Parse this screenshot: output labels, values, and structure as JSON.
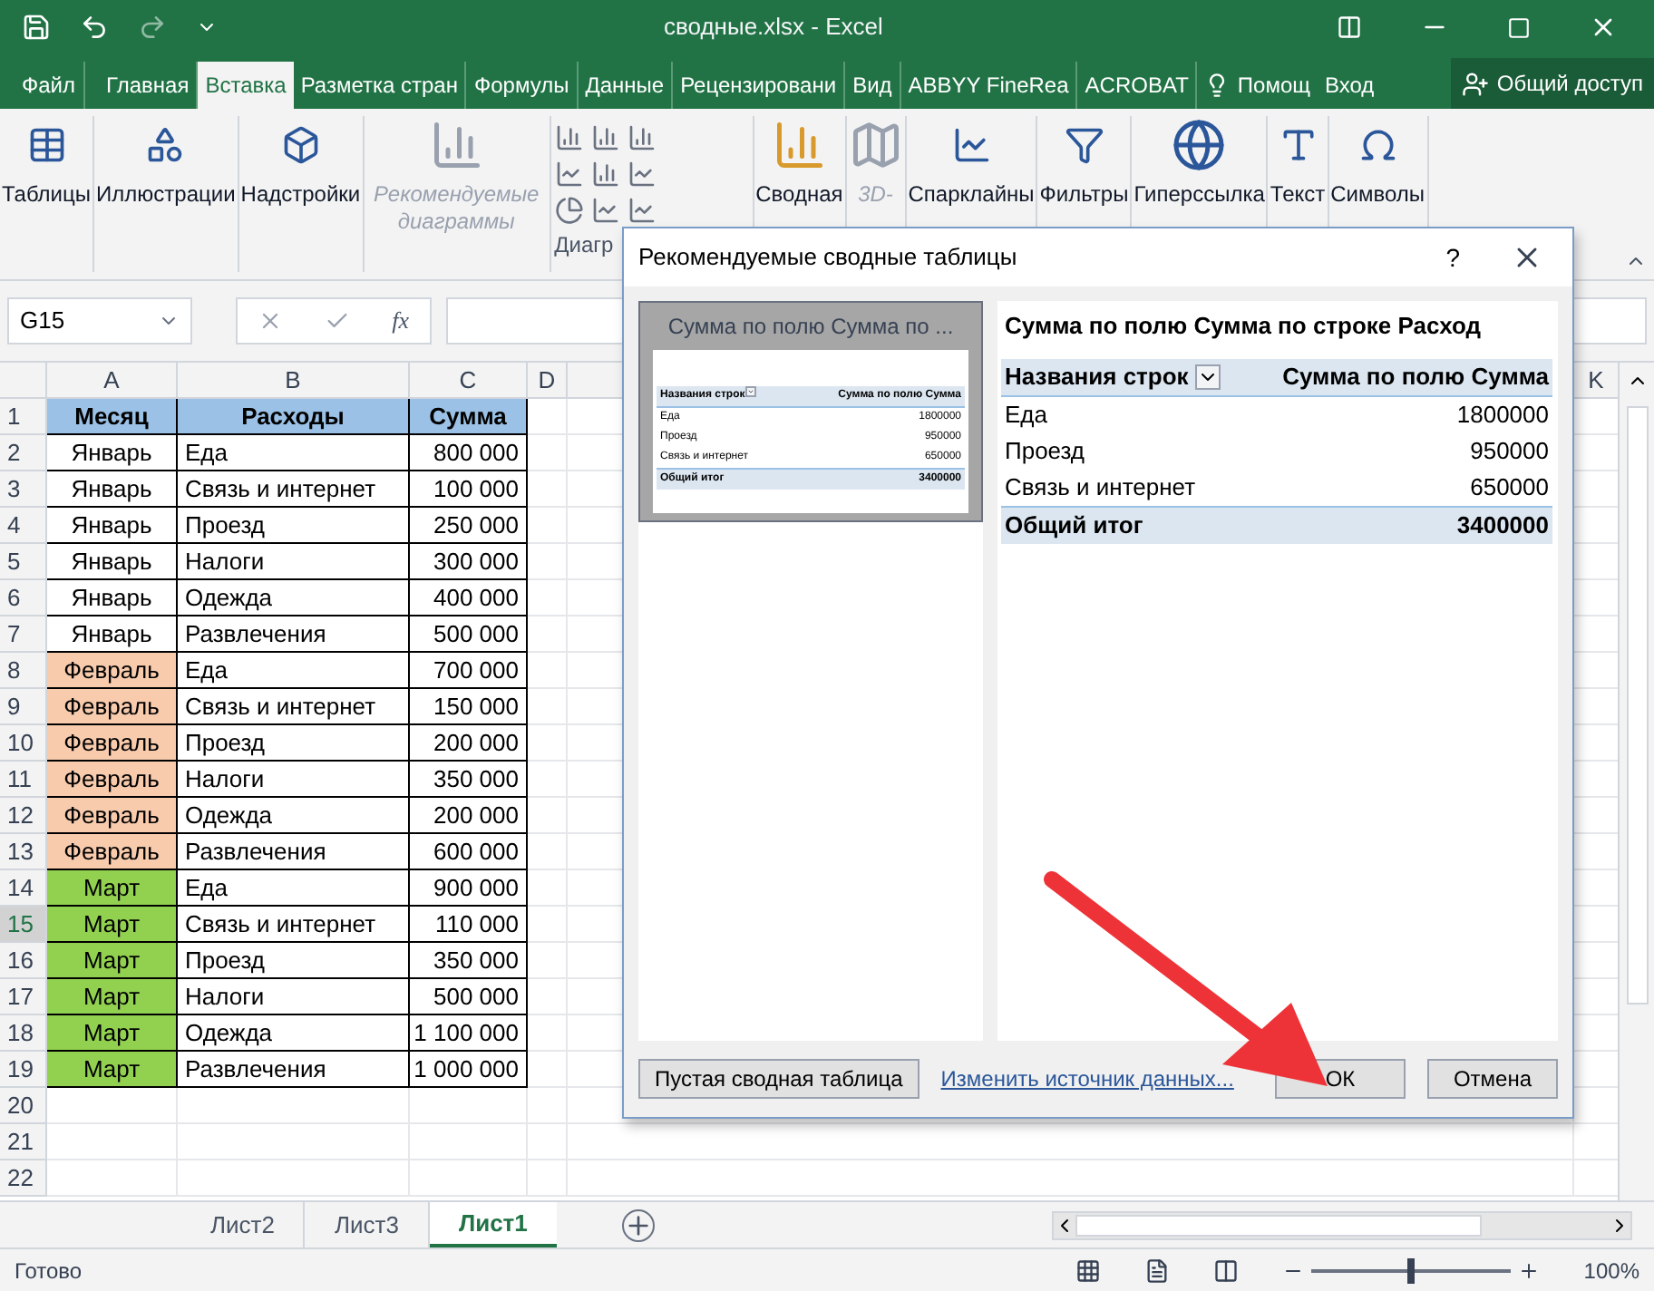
{
  "window": {
    "title": "сводные.xlsx - Excel"
  },
  "tabs": [
    {
      "label": "Файл",
      "selected": false
    },
    {
      "label": "Главная",
      "selected": false
    },
    {
      "label": "Вставка",
      "selected": true
    },
    {
      "label": "Разметка стран",
      "selected": false
    },
    {
      "label": "Формулы",
      "selected": false
    },
    {
      "label": "Данные",
      "selected": false
    },
    {
      "label": "Рецензировани",
      "selected": false
    },
    {
      "label": "Вид",
      "selected": false
    },
    {
      "label": "ABBYY FineRea",
      "selected": false
    },
    {
      "label": "ACROBAT",
      "selected": false
    }
  ],
  "help_tab": "Помощ",
  "signin": "Вход",
  "share": "Общий доступ",
  "ribbon": [
    {
      "kind": "table",
      "label": "Таблицы",
      "disabled": false
    },
    {
      "kind": "shapes",
      "label": "Иллюстрации",
      "disabled": false
    },
    {
      "kind": "addin",
      "label": "Надстройки",
      "disabled": false
    },
    {
      "kind": "recchart",
      "label": "Рекомендуемые диаграммы",
      "disabled": true
    },
    {
      "kind": "charts",
      "label": "Диагр",
      "disabled": false
    },
    {
      "kind": "pivotchart",
      "label": "Сводная",
      "disabled": false
    },
    {
      "kind": "map3d",
      "label": "3D-",
      "disabled": true
    },
    {
      "kind": "sparkline",
      "label": "Спарклайны",
      "disabled": false
    },
    {
      "kind": "filter",
      "label": "Фильтры",
      "disabled": false
    },
    {
      "kind": "link",
      "label": "Гиперссылка",
      "disabled": false
    },
    {
      "kind": "text",
      "label": "Текст",
      "disabled": false
    },
    {
      "kind": "symbol",
      "label": "Символы",
      "disabled": false
    }
  ],
  "name_box": "G15",
  "function_button": "fx",
  "columns": [
    "A",
    "B",
    "C",
    "D"
  ],
  "last_column": "K",
  "rows": [
    {
      "n": "1",
      "kind": "header",
      "selected": false,
      "cells": [
        "Месяц",
        "Расходы",
        "Сумма"
      ]
    },
    {
      "n": "2",
      "kind": "data",
      "selected": false,
      "color": "#ffffff",
      "cells": [
        "Январь",
        "Еда",
        "800 000"
      ]
    },
    {
      "n": "3",
      "kind": "data",
      "selected": false,
      "color": "#ffffff",
      "cells": [
        "Январь",
        "Связь и интернет",
        "100 000"
      ]
    },
    {
      "n": "4",
      "kind": "data",
      "selected": false,
      "color": "#ffffff",
      "cells": [
        "Январь",
        "Проезд",
        "250 000"
      ]
    },
    {
      "n": "5",
      "kind": "data",
      "selected": false,
      "color": "#ffffff",
      "cells": [
        "Январь",
        "Налоги",
        "300 000"
      ]
    },
    {
      "n": "6",
      "kind": "data",
      "selected": false,
      "color": "#ffffff",
      "cells": [
        "Январь",
        "Одежда",
        "400 000"
      ]
    },
    {
      "n": "7",
      "kind": "data",
      "selected": false,
      "color": "#ffffff",
      "cells": [
        "Январь",
        "Развлечения",
        "500 000"
      ]
    },
    {
      "n": "8",
      "kind": "data",
      "selected": false,
      "color": "#f8cbad",
      "cells": [
        "Февраль",
        "Еда",
        "700 000"
      ]
    },
    {
      "n": "9",
      "kind": "data",
      "selected": false,
      "color": "#f8cbad",
      "cells": [
        "Февраль",
        "Связь и интернет",
        "150 000"
      ]
    },
    {
      "n": "10",
      "kind": "data",
      "selected": false,
      "color": "#f8cbad",
      "cells": [
        "Февраль",
        "Проезд",
        "200 000"
      ]
    },
    {
      "n": "11",
      "kind": "data",
      "selected": false,
      "color": "#f8cbad",
      "cells": [
        "Февраль",
        "Налоги",
        "350 000"
      ]
    },
    {
      "n": "12",
      "kind": "data",
      "selected": false,
      "color": "#f8cbad",
      "cells": [
        "Февраль",
        "Одежда",
        "200 000"
      ]
    },
    {
      "n": "13",
      "kind": "data",
      "selected": false,
      "color": "#f8cbad",
      "cells": [
        "Февраль",
        "Развлечения",
        "600 000"
      ]
    },
    {
      "n": "14",
      "kind": "data",
      "selected": false,
      "color": "#92d050",
      "cells": [
        "Март",
        "Еда",
        "900 000"
      ]
    },
    {
      "n": "15",
      "kind": "data",
      "selected": true,
      "color": "#92d050",
      "cells": [
        "Март",
        "Связь и интернет",
        "110 000"
      ]
    },
    {
      "n": "16",
      "kind": "data",
      "selected": false,
      "color": "#92d050",
      "cells": [
        "Март",
        "Проезд",
        "350 000"
      ]
    },
    {
      "n": "17",
      "kind": "data",
      "selected": false,
      "color": "#92d050",
      "cells": [
        "Март",
        "Налоги",
        "500 000"
      ]
    },
    {
      "n": "18",
      "kind": "data",
      "selected": false,
      "color": "#92d050",
      "cells": [
        "Март",
        "Одежда",
        "1 100 000"
      ]
    },
    {
      "n": "19",
      "kind": "data",
      "selected": false,
      "color": "#92d050",
      "cells": [
        "Март",
        "Развлечения",
        "1 000 000"
      ]
    },
    {
      "n": "20",
      "kind": "empty",
      "selected": false,
      "cells": []
    },
    {
      "n": "21",
      "kind": "empty",
      "selected": false,
      "cells": []
    },
    {
      "n": "22",
      "kind": "empty",
      "selected": false,
      "cells": []
    }
  ],
  "sheets": [
    {
      "label": "Лист2",
      "selected": false
    },
    {
      "label": "Лист3",
      "selected": false
    },
    {
      "label": "Лист1",
      "selected": true
    }
  ],
  "status": {
    "text": "Готово",
    "zoom": {
      "level": 0.5,
      "reading": "100%"
    }
  },
  "dialog": {
    "title": "Рекомендуемые сводные таблицы",
    "help": "?",
    "preview": {
      "selected": true,
      "caption": "Сумма по полю Сумма по ...",
      "header": [
        "Названия строк",
        "Сумма по полю Сумма"
      ],
      "rows": [
        [
          "Еда",
          "1800000"
        ],
        [
          "Проезд",
          "950000"
        ],
        [
          "Связь и интернет",
          "650000"
        ]
      ],
      "total": [
        "Общий итог",
        "3400000"
      ]
    },
    "pivot": {
      "title": "Сумма по полю Сумма по строке Расход",
      "header": [
        "Названия строк",
        "Сумма по полю Сумма"
      ],
      "rows": [
        [
          "Еда",
          "1800000"
        ],
        [
          "Проезд",
          "950000"
        ],
        [
          "Связь и интернет",
          "650000"
        ]
      ],
      "total": [
        "Общий итог",
        "3400000"
      ]
    },
    "blank_button": "Пустая сводная таблица",
    "source_link": "Изменить источник данных...",
    "ok": "ОК",
    "cancel": "Отмена"
  }
}
